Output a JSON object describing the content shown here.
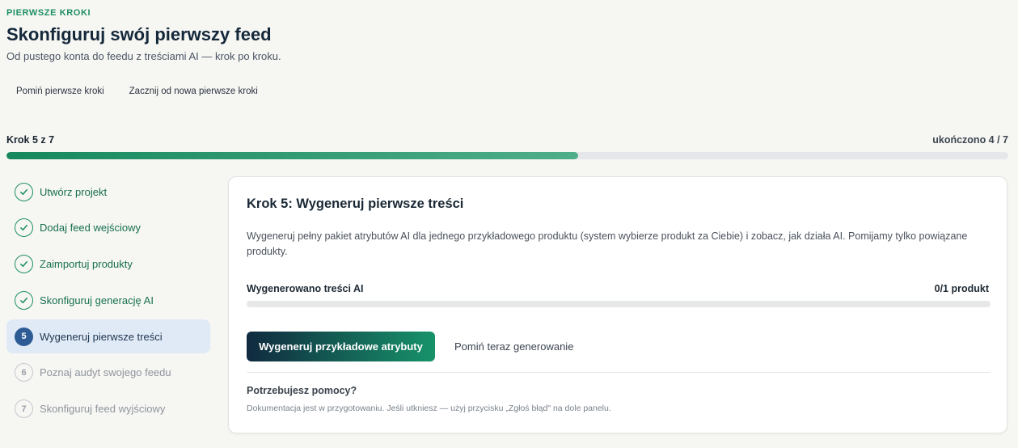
{
  "header": {
    "eyebrow": "PIERWSZE KROKI",
    "title": "Skonfiguruj swój pierwszy feed",
    "subtitle": "Od pustego konta do feedu z treściami AI — krok po kroku."
  },
  "top_actions": {
    "skip_label": "Pomiń pierwsze kroki",
    "restart_label": "Zacznij od nowa pierwsze kroki"
  },
  "progress": {
    "step_label": "Krok 5 z 7",
    "completed_label": "ukończono 4 / 7",
    "fraction": 0.571,
    "fill_color": "#16885e"
  },
  "steps": [
    {
      "number": "1",
      "label": "Utwórz projekt",
      "state": "done",
      "icon": "check-icon"
    },
    {
      "number": "2",
      "label": "Dodaj feed wejściowy",
      "state": "done",
      "icon": "check-icon"
    },
    {
      "number": "3",
      "label": "Zaimportuj produkty",
      "state": "done",
      "icon": "check-icon"
    },
    {
      "number": "4",
      "label": "Skonfiguruj generację AI",
      "state": "done",
      "icon": "check-icon"
    },
    {
      "number": "5",
      "label": "Wygeneruj pierwsze treści",
      "state": "active"
    },
    {
      "number": "6",
      "label": "Poznaj audyt swojego feedu",
      "state": "todo"
    },
    {
      "number": "7",
      "label": "Skonfiguruj feed wyjściowy",
      "state": "todo"
    }
  ],
  "card": {
    "title": "Krok 5: Wygeneruj pierwsze treści",
    "description": "Wygeneruj pełny pakiet atrybutów AI dla jednego przykładowego produktu (system wybierze produkt za Ciebie) i zobacz, jak działa AI. Pomijamy tylko powiązane produkty.",
    "generated_label": "Wygenerowano treści AI",
    "generated_count": "0/1 produkt",
    "generated_fraction": 0,
    "primary_button": "Wygeneruj przykładowe atrybuty",
    "secondary_button": "Pomiń teraz generowanie",
    "help_title": "Potrzebujesz pomocy?",
    "help_text": "Dokumentacja jest w przygotowaniu. Jeśli utkniesz — użyj przycisku „Zgłoś błąd\" na dole panelu."
  },
  "colors": {
    "accent_green": "#1f8f66",
    "active_blue": "#2d5c95",
    "active_bg": "#e0eaf6",
    "page_bg": "#f6f6f3"
  }
}
